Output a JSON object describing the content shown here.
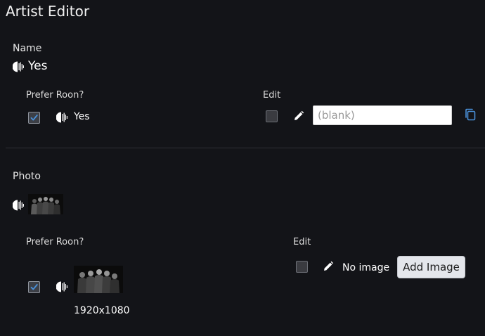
{
  "page": {
    "title": "Artist Editor"
  },
  "name_section": {
    "label": "Name",
    "current_value": "Yes",
    "prefer_roon_label": "Prefer Roon?",
    "roon_value": "Yes",
    "prefer_roon_checked": true,
    "edit_label": "Edit",
    "edit_checked": false,
    "edit_placeholder": "(blank)",
    "edit_value": ""
  },
  "photo_section": {
    "label": "Photo",
    "prefer_roon_label": "Prefer Roon?",
    "prefer_roon_checked": true,
    "roon_image_resolution": "1920x1080",
    "edit_label": "Edit",
    "edit_checked": false,
    "no_image_text": "No image",
    "add_image_label": "Add Image"
  },
  "colors": {
    "background": "#131418",
    "accent_blue": "#4a90d9",
    "divider": "#2e3036"
  },
  "icons": [
    "roon-logo-icon",
    "checkmark-icon",
    "pencil-icon",
    "copy-icon"
  ]
}
